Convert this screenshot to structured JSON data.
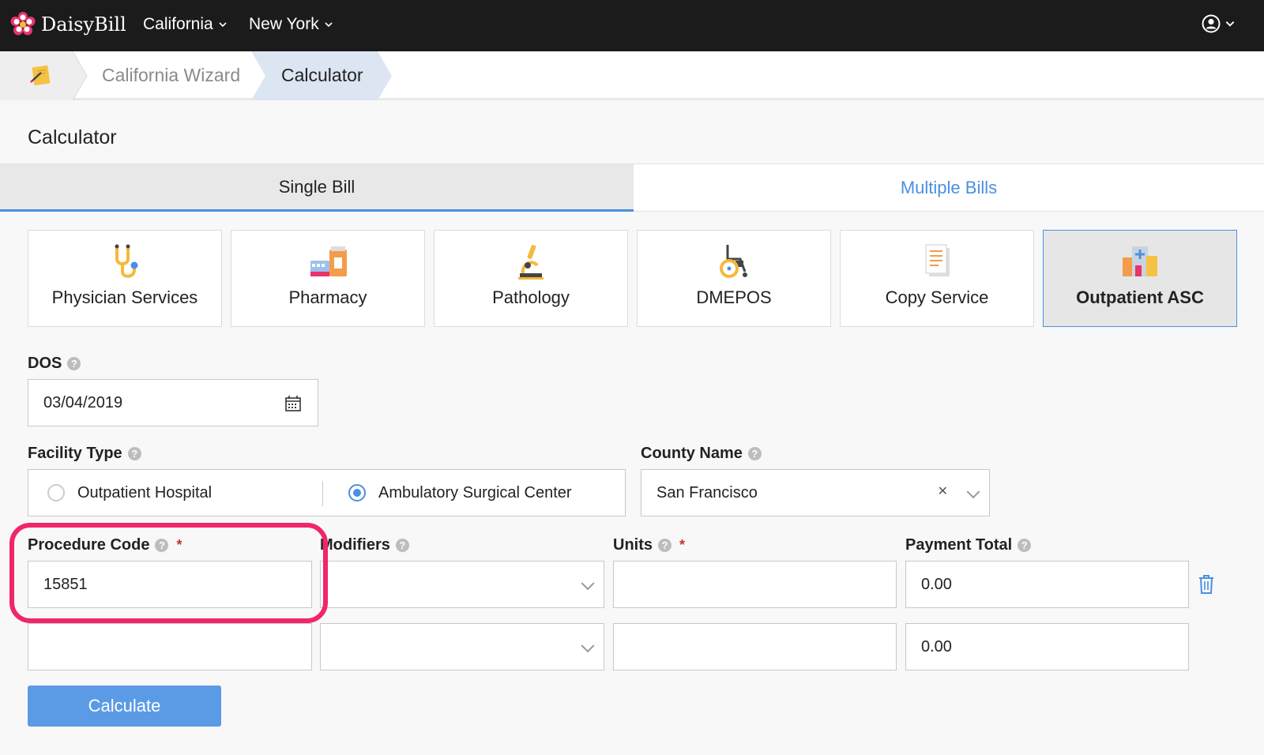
{
  "app": {
    "name": "DaisyBill"
  },
  "nav": {
    "items": [
      {
        "label": "California"
      },
      {
        "label": "New York"
      }
    ]
  },
  "breadcrumb": {
    "items": [
      {
        "label": "California Wizard"
      },
      {
        "label": "Calculator"
      }
    ]
  },
  "page": {
    "title": "Calculator"
  },
  "tabs": [
    {
      "label": "Single Bill",
      "active": true
    },
    {
      "label": "Multiple Bills",
      "active": false
    }
  ],
  "services": [
    {
      "label": "Physician Services",
      "icon": "stethoscope-icon"
    },
    {
      "label": "Pharmacy",
      "icon": "pharmacy-icon"
    },
    {
      "label": "Pathology",
      "icon": "microscope-icon"
    },
    {
      "label": "DMEPOS",
      "icon": "wheelchair-icon"
    },
    {
      "label": "Copy Service",
      "icon": "document-icon"
    },
    {
      "label": "Outpatient ASC",
      "icon": "hospital-icon",
      "selected": true
    }
  ],
  "form": {
    "dos": {
      "label": "DOS",
      "value": "03/04/2019"
    },
    "facility_type": {
      "label": "Facility Type",
      "options": [
        {
          "label": "Outpatient Hospital",
          "selected": false
        },
        {
          "label": "Ambulatory Surgical Center",
          "selected": true
        }
      ]
    },
    "county": {
      "label": "County Name",
      "value": "San Francisco",
      "clear_glyph": "✕"
    },
    "columns": {
      "procedure_code": "Procedure Code",
      "modifiers": "Modifiers",
      "units": "Units",
      "payment_total": "Payment Total",
      "required_mark": "*"
    },
    "rows": [
      {
        "procedure_code": "15851",
        "modifiers": "",
        "units": "",
        "payment_total": "0.00"
      },
      {
        "procedure_code": "",
        "modifiers": "",
        "units": "",
        "payment_total": "0.00"
      }
    ],
    "help_glyph": "?",
    "calculate_label": "Calculate"
  },
  "colors": {
    "accent": "#4a90e2",
    "highlight": "#f0266b",
    "topbar": "#1b1b1b"
  }
}
